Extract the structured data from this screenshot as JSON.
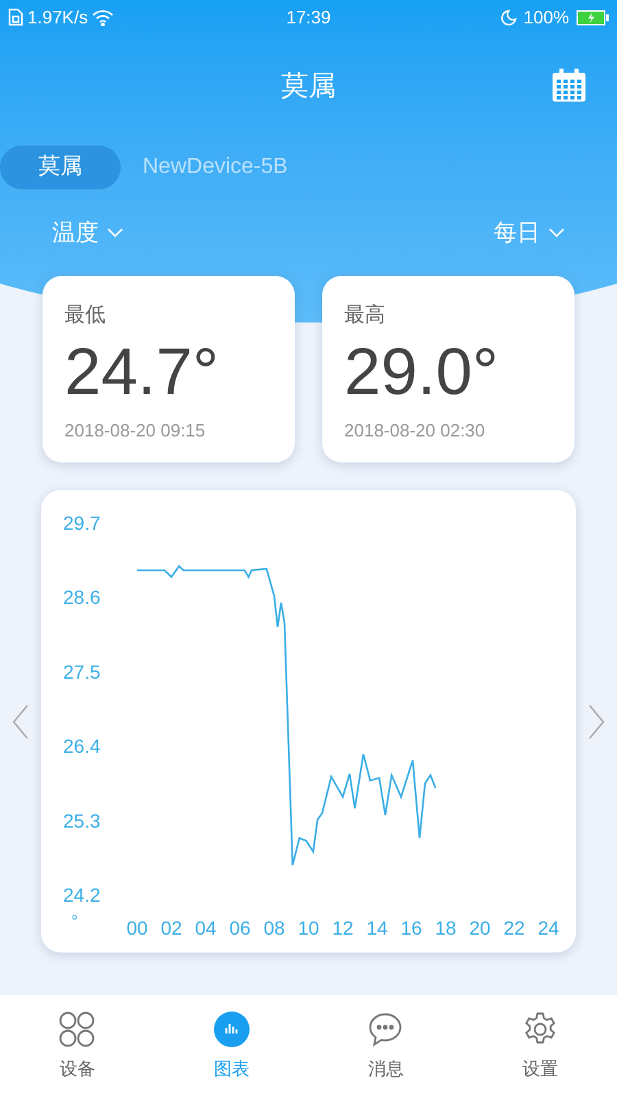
{
  "status_bar": {
    "speed": "1.97K/s",
    "time": "17:39",
    "battery": "100%"
  },
  "header": {
    "title": "莫属"
  },
  "devices": [
    {
      "label": "莫属",
      "selected": true
    },
    {
      "label": "NewDevice-5B",
      "selected": false
    }
  ],
  "metric_selector": "温度",
  "period_selector": "每日",
  "stats": [
    {
      "label": "最低",
      "value": "24.7°",
      "time": "2018-08-20 09:15"
    },
    {
      "label": "最高",
      "value": "29.0°",
      "time": "2018-08-20 02:30"
    }
  ],
  "chart": {
    "chart_data": {
      "type": "line",
      "ylabel": "°",
      "xlim": [
        0,
        24
      ],
      "ylim": [
        24.2,
        29.7
      ],
      "xticks": [
        {
          "value": 0,
          "label": "00"
        },
        {
          "value": 2,
          "label": "02"
        },
        {
          "value": 4,
          "label": "04"
        },
        {
          "value": 6,
          "label": "06"
        },
        {
          "value": 8,
          "label": "08"
        },
        {
          "value": 10,
          "label": "10"
        },
        {
          "value": 12,
          "label": "12"
        },
        {
          "value": 14,
          "label": "14"
        },
        {
          "value": 16,
          "label": "16"
        },
        {
          "value": 18,
          "label": "18"
        },
        {
          "value": 20,
          "label": "20"
        },
        {
          "value": 22,
          "label": "22"
        },
        {
          "value": 24,
          "label": "24"
        }
      ],
      "yticks": [
        24.2,
        25.3,
        26.4,
        27.5,
        28.6,
        29.7
      ],
      "x": [
        0,
        1.6,
        2.0,
        2.45,
        2.7,
        6.27,
        6.5,
        6.67,
        7.55,
        8.0,
        8.2,
        8.4,
        8.6,
        9.07,
        9.47,
        9.87,
        10.27,
        10.53,
        10.8,
        11.33,
        12.0,
        12.4,
        12.7,
        13.2,
        13.6,
        14.13,
        14.48,
        14.85,
        15.4,
        16.08,
        16.48,
        16.8,
        17.12,
        17.41
      ],
      "series": [
        {
          "color": "#3aaee6",
          "values": [
            29.0,
            29.0,
            28.9,
            29.06,
            29.0,
            29.0,
            28.9,
            29.0,
            29.02,
            28.62,
            28.16,
            28.52,
            28.22,
            24.64,
            25.04,
            25.0,
            24.84,
            25.31,
            25.41,
            25.95,
            25.65,
            25.99,
            25.48,
            26.28,
            25.89,
            25.93,
            25.38,
            25.97,
            25.65,
            26.19,
            25.04,
            25.85,
            25.97,
            25.78
          ]
        }
      ]
    }
  },
  "nav": [
    {
      "label": "设备",
      "selected": false
    },
    {
      "label": "图表",
      "selected": true
    },
    {
      "label": "消息",
      "selected": false
    },
    {
      "label": "设置",
      "selected": false
    }
  ]
}
